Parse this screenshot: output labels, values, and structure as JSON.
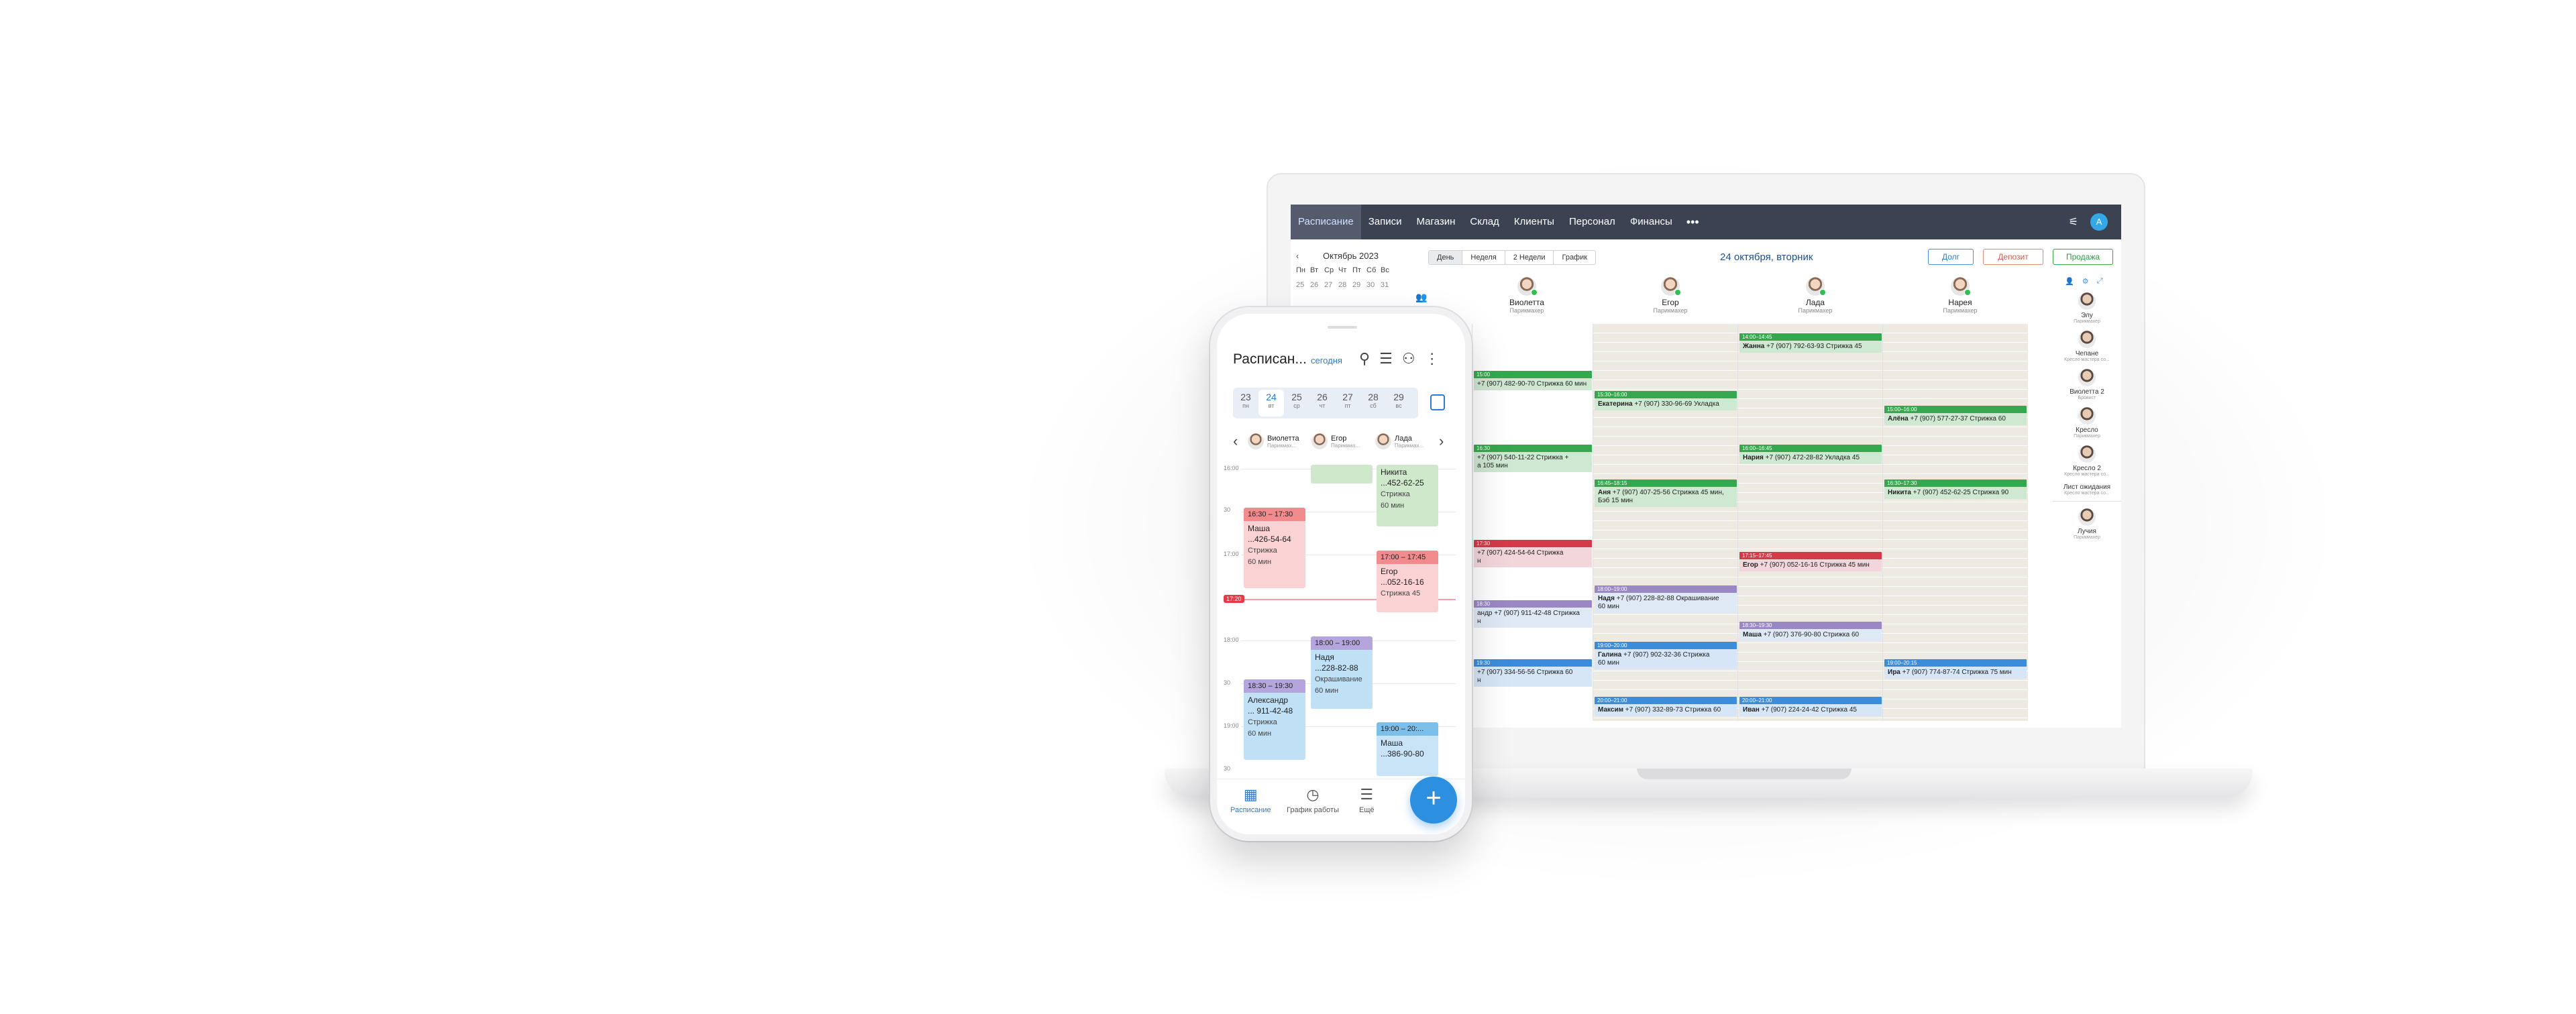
{
  "nav": {
    "items": [
      "Расписание",
      "Записи",
      "Магазин",
      "Склад",
      "Клиенты",
      "Персонал",
      "Финансы"
    ],
    "more": "•••",
    "settings_icon": "sliders-icon",
    "avatar_letter": "А"
  },
  "mini_calendar": {
    "prev": "‹",
    "month": "Октябрь 2023",
    "weekdays": [
      "Пн",
      "Вт",
      "Ср",
      "Чт",
      "Пт",
      "Сб",
      "Вс"
    ],
    "days": [
      "25",
      "26",
      "27",
      "28",
      "29",
      "30",
      "31"
    ]
  },
  "toolbar": {
    "views": [
      "День",
      "Неделя",
      "2 Недели",
      "График"
    ],
    "date_title": "24 октября, вторник",
    "debt": "Долг",
    "deposit": "Депозит",
    "sale": "Продажа"
  },
  "staff": [
    {
      "name": "Виолетта",
      "role": "Парикмахер"
    },
    {
      "name": "Егор",
      "role": "Парикмахер"
    },
    {
      "name": "Лада",
      "role": "Парикмахер"
    },
    {
      "name": "Нарея",
      "role": "Парикмахер"
    }
  ],
  "events": {
    "col1": [
      {
        "time": "15:00",
        "text": "+7 (907) 482-90-70 Стрижка 60 мин"
      },
      {
        "time": "16:30",
        "text": "+7 (907) 540-11-22 Стрижка + ",
        "extra": "а 105 мин"
      },
      {
        "time": "17:30",
        "text": "+7 (907) 424-54-64 Стрижка ",
        "extra": "н"
      },
      {
        "time": "18:30",
        "text": "андр +7 (907) 911-42-48 Стрижка",
        "extra": "н"
      },
      {
        "time": "19:30",
        "text": "+7 (907) 334-56-56 Стрижка 60",
        "extra": "н"
      }
    ],
    "col2": [
      {
        "time": "15:30–16:00",
        "name": "Екатерина",
        "text": "+7 (907) 330-96-69 Укладка"
      },
      {
        "time": "16:45–18:15",
        "name": "Аня",
        "text": "+7 (907) 407-25-56 Стрижка 45 мин, ",
        "extra": "Бэб 15 мин"
      },
      {
        "time": "18:00–19:00",
        "name": "Надя",
        "text": "+7 (907) 228-82-88 Окрашивание",
        "extra": "60 мин"
      },
      {
        "time": "19:00–20:00",
        "name": "Галина",
        "text": "+7 (907) 902-32-36 Стрижка",
        "extra": "60 мин"
      },
      {
        "time": "20:00–21:00",
        "name": "Максим",
        "text": "+7 (907) 332-89-73 Стрижка 60"
      }
    ],
    "col3": [
      {
        "time": "14:00–14:45",
        "name": "Жанна",
        "text": "+7 (907) 792-63-93 Стрижка 45"
      },
      {
        "time": "16:00–16:45",
        "name": "Нария",
        "text": "+7 (907) 472-28-82 Укладка 45"
      },
      {
        "time": "17:15–17:45",
        "name": "Егор",
        "text": "+7 (907) 052-16-16 Стрижка 45 мин"
      },
      {
        "time": "18:30–19:30",
        "name": "Маша",
        "text": "+7 (907) 376-90-80 Стрижка 60"
      },
      {
        "time": "20:00–21:00",
        "name": "Иван",
        "text": "+7 (907) 224-24-42 Стрижка 45"
      }
    ],
    "col4": [
      {
        "time": "15:00–16:00",
        "name": "Алёна",
        "text": "+7 (907) 577-27-37 Стрижка 60"
      },
      {
        "time": "16:30–17:30",
        "name": "Никита",
        "text": "+7 (907) 452-62-25 Стрижка 90"
      },
      {
        "time": "19:00–20:15",
        "name": "Ира",
        "text": "+7 (907) 774-87-74 Стрижка 75 мин"
      }
    ]
  },
  "right_panel": {
    "tools": [
      "👤",
      "⚙",
      "⤢"
    ],
    "items": [
      {
        "name": "Элу",
        "role": "Парикмахер"
      },
      {
        "name": "Чепане",
        "role": "Кресло мастера со..."
      },
      {
        "name": "Виолетта 2",
        "role": "Бровист"
      },
      {
        "name": "Кресло",
        "role": "Парикмахер"
      },
      {
        "name": "Кресло 2",
        "role": "Кресло мастера со..."
      },
      {
        "name": "Лист ожидания",
        "role": "Кресло мастера со..."
      },
      {
        "name": "Лучия",
        "role": "Парикмахер"
      }
    ]
  },
  "phone": {
    "title": "Расписан...",
    "today": "сегодня",
    "week": [
      {
        "n": "23",
        "w": "пн"
      },
      {
        "n": "24",
        "w": "вт"
      },
      {
        "n": "25",
        "w": "ср"
      },
      {
        "n": "26",
        "w": "чт"
      },
      {
        "n": "27",
        "w": "пт"
      },
      {
        "n": "28",
        "w": "сб"
      },
      {
        "n": "29",
        "w": "вс"
      }
    ],
    "staff": [
      {
        "name": "Виолетта",
        "role": "Парикмах..."
      },
      {
        "name": "Егор",
        "role": "Парикмах..."
      },
      {
        "name": "Лада",
        "role": "Парикмах..."
      }
    ],
    "times": [
      "16:00",
      "30",
      "17:00",
      "18:00",
      "30",
      "19:00",
      "30"
    ],
    "now": "17:20",
    "events": [
      {
        "hd": "16:30 – 17:30",
        "name": "Маша",
        "phone": "...426-54-64",
        "svc": "Стрижка",
        "dur": "60 мин"
      },
      {
        "hd": "",
        "name": "Никита",
        "phone": "...452-62-25",
        "svc": "Стрижка",
        "dur": "60 мин"
      },
      {
        "hd": "17:00 – 17:45",
        "name": "Егор",
        "phone": "...052-16-16",
        "svc": "Стрижка 45",
        "dur": ""
      },
      {
        "hd": "18:00 – 19:00",
        "name": "Надя",
        "phone": "...228-82-88",
        "svc": "Окрашивание",
        "dur": "60 мин"
      },
      {
        "hd": "18:30 – 19:30",
        "name": "Александр",
        "phone": "... 911-42-48",
        "svc": "Стрижка",
        "dur": "60 мин"
      },
      {
        "hd": "19:00 – 20:...",
        "name": "Маша",
        "phone": "...386-90-80",
        "svc": "",
        "dur": ""
      }
    ],
    "tabs": [
      "Расписание",
      "График работы",
      "Ещё"
    ]
  }
}
